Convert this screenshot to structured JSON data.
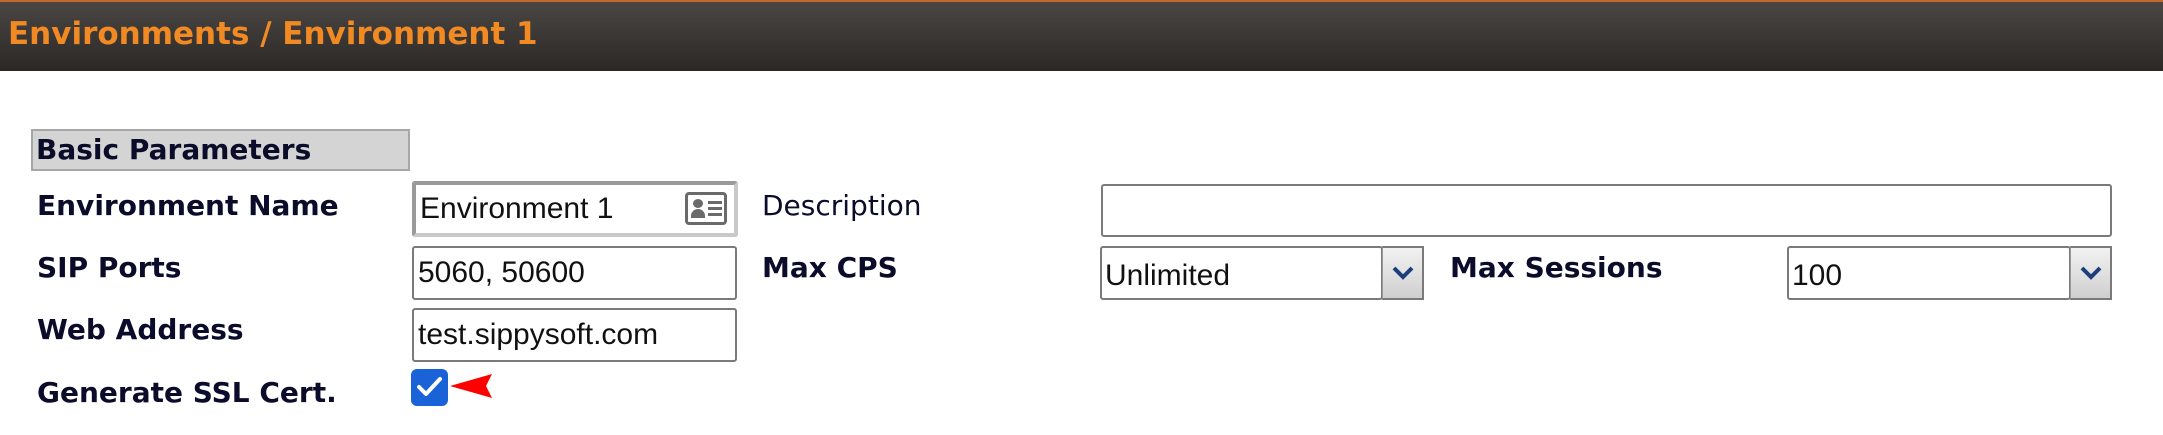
{
  "header": {
    "breadcrumb": "Environments / Environment 1"
  },
  "section": {
    "title": "Basic Parameters"
  },
  "fields": {
    "environment_name": {
      "label": "Environment Name",
      "value": "Environment 1"
    },
    "description": {
      "label": "Description",
      "value": ""
    },
    "sip_ports": {
      "label": "SIP Ports",
      "value": "5060, 50600"
    },
    "max_cps": {
      "label": "Max CPS",
      "value": "Unlimited"
    },
    "max_sessions": {
      "label": "Max Sessions",
      "value": "100"
    },
    "web_address": {
      "label": "Web Address",
      "value": "test.sippysoft.com"
    },
    "generate_ssl": {
      "label": "Generate SSL Cert.",
      "checked": true
    }
  },
  "icons": {
    "contact_card": "contact-card-icon",
    "dropdown": "chevron-down-icon",
    "check": "checkmark-icon",
    "pointer": "red-arrow-pointer"
  },
  "colors": {
    "header_text": "#f28a24",
    "header_bg": "#2b2826",
    "checkbox": "#1a62d8",
    "pointer": "#ff0000"
  }
}
